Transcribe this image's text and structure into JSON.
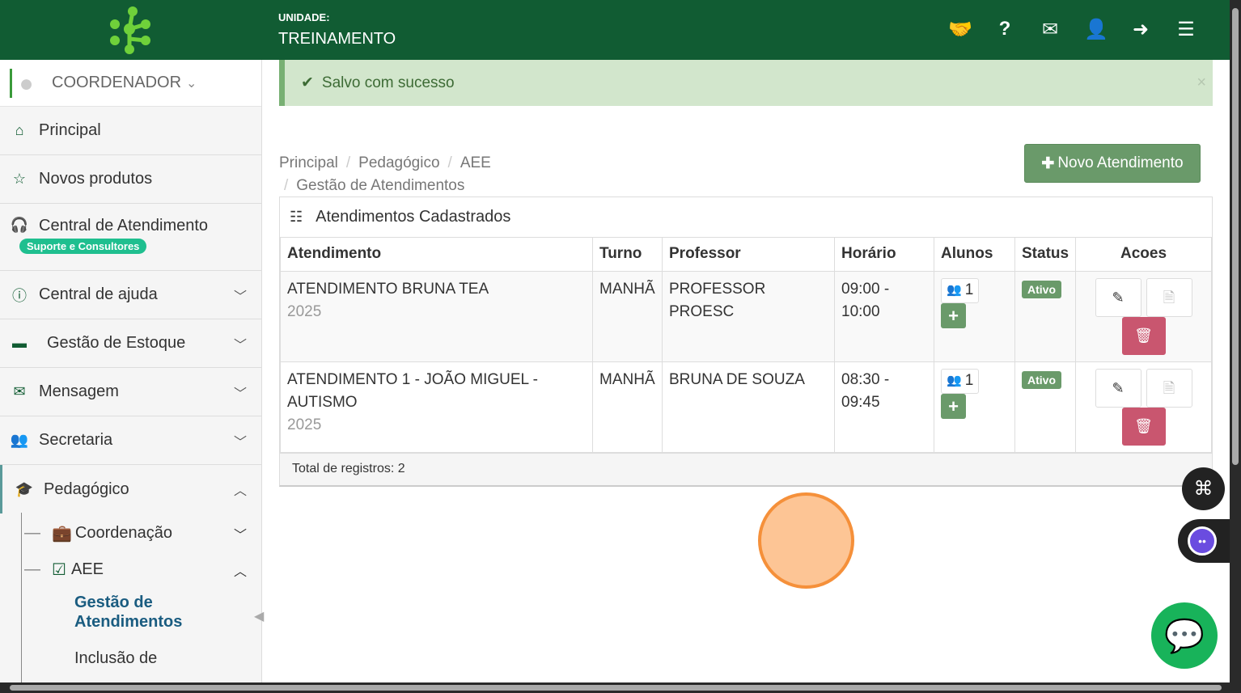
{
  "header": {
    "unit_label": "UNIDADE:",
    "unit_value": "TREINAMENTO",
    "icons": [
      "handshake-icon",
      "question-icon",
      "envelope-icon",
      "user-icon",
      "sign-out-icon",
      "menu-icon"
    ]
  },
  "sidebar": {
    "user_role": "COORDENADOR",
    "items": [
      {
        "label": "Principal",
        "icon": "home-icon"
      },
      {
        "label": "Novos produtos",
        "icon": "star-icon"
      },
      {
        "label": "Central de Atendimento",
        "icon": "headset-icon",
        "badge": "Suporte e Consultores"
      },
      {
        "label": "Central de ajuda",
        "icon": "info-icon"
      },
      {
        "label": "Gestão de Estoque",
        "icon": "archive-icon"
      },
      {
        "label": "Mensagem",
        "icon": "envelope-icon"
      },
      {
        "label": "Secretaria",
        "icon": "users-icon"
      },
      {
        "label": "Pedagógico",
        "icon": "graduation-icon"
      }
    ],
    "sub": {
      "coordenacao": "Coordenação",
      "aee": "AEE",
      "gestao": "Gestão de Atendimentos",
      "inclusao": "Inclusão de"
    }
  },
  "alert": {
    "message": "Salvo com sucesso",
    "close": "×"
  },
  "breadcrumb": [
    "Principal",
    "Pedagógico",
    "AEE",
    "Gestão de Atendimentos"
  ],
  "new_button": "Novo Atendimento",
  "panel": {
    "title": "Atendimentos Cadastrados",
    "columns": [
      "Atendimento",
      "Turno",
      "Professor",
      "Horário",
      "Alunos",
      "Status",
      "Acoes"
    ],
    "rows": [
      {
        "name": "ATENDIMENTO BRUNA TEA",
        "year": "2025",
        "turno": "MANHÃ",
        "professor": "PROFESSOR PROESC",
        "horario": "09:00 - 10:00",
        "alunos": "1",
        "status": "Ativo"
      },
      {
        "name": "ATENDIMENTO 1 - JOÃO MIGUEL - AUTISMO",
        "year": "2025",
        "turno": "MANHÃ",
        "professor": "BRUNA DE SOUZA",
        "horario": "08:30 - 09:45",
        "alunos": "1",
        "status": "Ativo"
      }
    ],
    "footer": "Total de registros: 2"
  },
  "colors": {
    "header": "#115c33",
    "success": "#6a9a6a",
    "danger": "#c9566f",
    "badge": "#1fbf8f"
  }
}
